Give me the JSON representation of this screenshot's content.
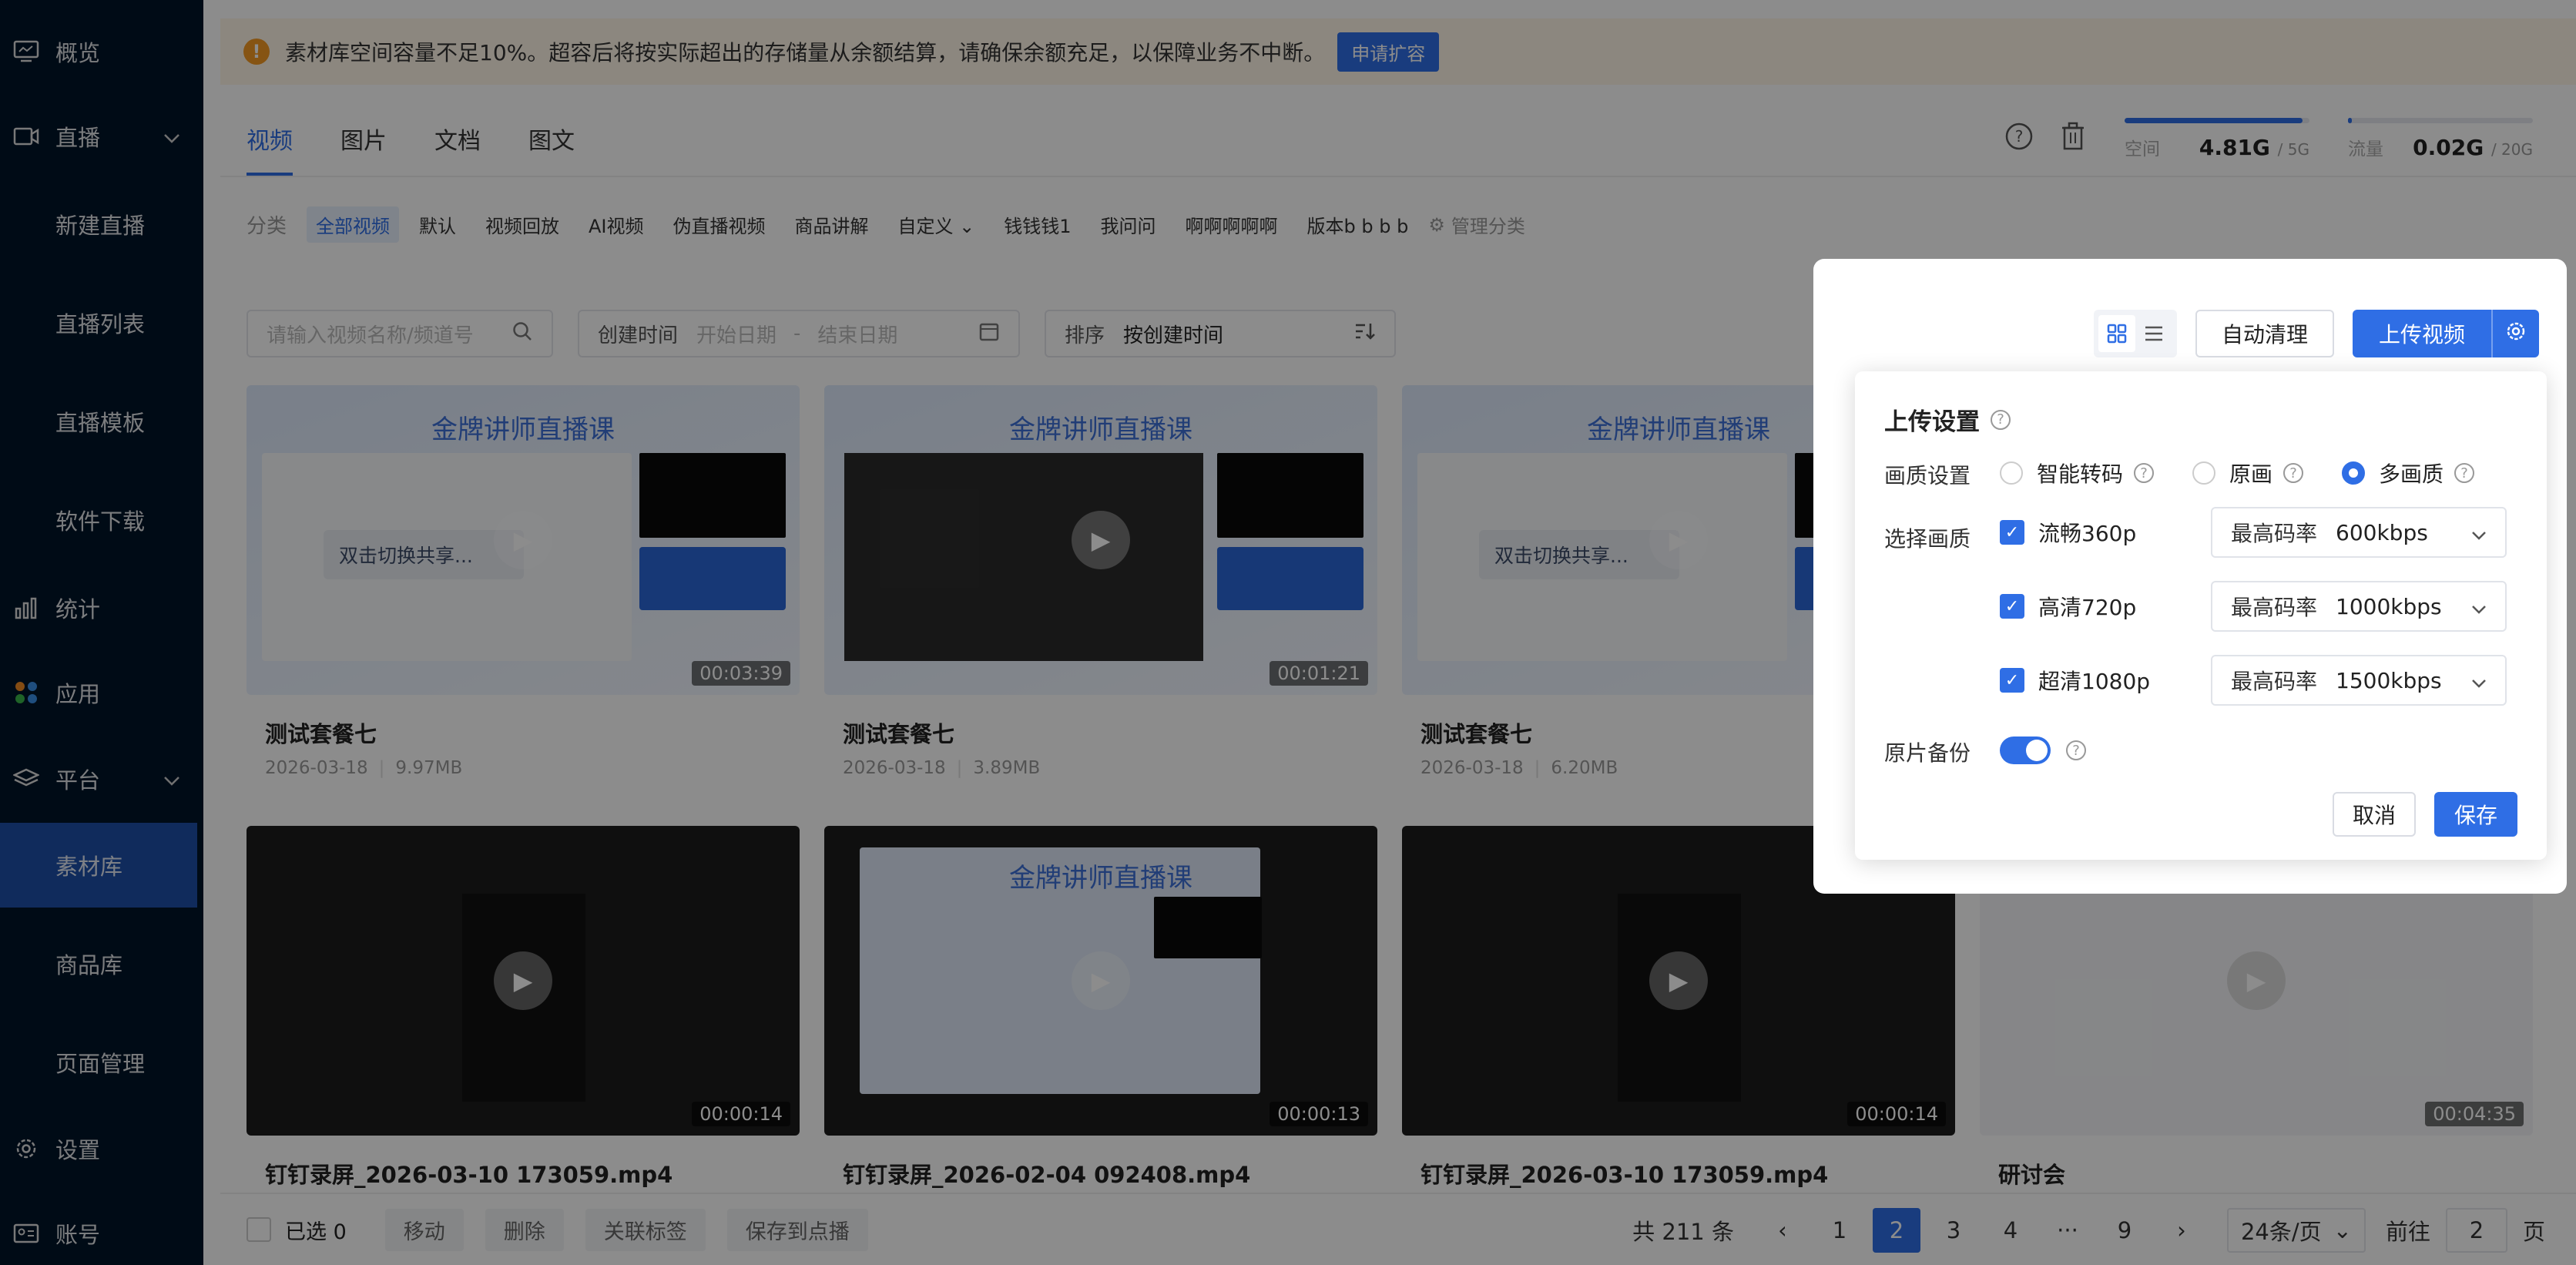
{
  "sidebar": {
    "items": [
      {
        "label": "概览",
        "icon": "monitor-icon"
      },
      {
        "label": "直播",
        "icon": "video-camera-icon"
      },
      {
        "label": "新建直播"
      },
      {
        "label": "直播列表"
      },
      {
        "label": "直播模板"
      },
      {
        "label": "软件下载"
      },
      {
        "label": "统计",
        "icon": "bar-chart-icon"
      },
      {
        "label": "应用",
        "icon": "apps-icon"
      },
      {
        "label": "平台",
        "icon": "layers-icon"
      },
      {
        "label": "素材库"
      },
      {
        "label": "商品库"
      },
      {
        "label": "页面管理"
      },
      {
        "label": "设置",
        "icon": "gear-icon"
      },
      {
        "label": "账号",
        "icon": "id-card-icon"
      }
    ]
  },
  "alert": {
    "text": "素材库空间容量不足10%。超容后将按实际超出的存储量从余额结算，请确保余额充足，以保障业务不中断。",
    "button": "申请扩容"
  },
  "tabs": [
    "视频",
    "图片",
    "文档",
    "图文"
  ],
  "quota": {
    "space_label": "空间",
    "space_used": "4.81G",
    "space_total": "/ 5G",
    "space_fraction": 0.962,
    "flow_label": "流量",
    "flow_used": "0.02G",
    "flow_total": "/ 20G",
    "flow_fraction": 0.001
  },
  "categories": {
    "label": "分类",
    "items": [
      "全部视频",
      "默认",
      "视频回放",
      "AI视频",
      "伪直播视频",
      "商品讲解",
      "自定义",
      "钱钱钱1",
      "我问问",
      "啊啊啊啊啊",
      "版本b b b b"
    ],
    "manage": "管理分类"
  },
  "filters": {
    "search_placeholder": "请输入视频名称/频道号",
    "date_label": "创建时间",
    "date_start": "开始日期",
    "date_sep": "-",
    "date_end": "结束日期",
    "sort_label": "排序",
    "sort_value": "按创建时间"
  },
  "thumb_text": {
    "heading": "金牌讲师直播课",
    "share": "双击切换共享..."
  },
  "videos": [
    {
      "title": "测试套餐七",
      "date": "2026-03-18",
      "size": "9.97MB",
      "duration": "00:03:39"
    },
    {
      "title": "测试套餐七",
      "date": "2026-03-18",
      "size": "3.89MB",
      "duration": "00:01:21"
    },
    {
      "title": "测试套餐七",
      "date": "2026-03-18",
      "size": "6.20MB",
      "duration": ""
    },
    {
      "title": "钉钉录屏_2026-03-10 173059.mp4",
      "duration": "00:00:14"
    },
    {
      "title": "钉钉录屏_2026-02-04 092408.mp4",
      "duration": "00:00:13"
    },
    {
      "title": "钉钉录屏_2026-03-10 173059.mp4",
      "duration": "00:00:14"
    },
    {
      "title": "研讨会",
      "duration": "00:04:35"
    }
  ],
  "bottom": {
    "selected": "已选 0",
    "actions": [
      "移动",
      "删除",
      "关联标签",
      "保存到点播"
    ]
  },
  "pager": {
    "total": "共 211 条",
    "prev": "‹",
    "pages": [
      "1",
      "2",
      "3",
      "4",
      "···",
      "9"
    ],
    "current": "2",
    "next": "›",
    "page_size": "24条/页",
    "goto_label": "前往",
    "goto_value": "2",
    "goto_suffix": "页"
  },
  "popover": {
    "auto_clean": "自动清理",
    "upload": "上传视频",
    "panel": {
      "title": "上传设置",
      "quality_label": "画质设置",
      "quality_options": [
        "智能转码",
        "原画",
        "多画质"
      ],
      "quality_selected": "多画质",
      "select_label": "选择画质",
      "rows": [
        {
          "name": "流畅360p",
          "rate_label": "最高码率",
          "rate": "600kbps"
        },
        {
          "name": "高清720p",
          "rate_label": "最高码率",
          "rate": "1000kbps"
        },
        {
          "name": "超清1080p",
          "rate_label": "最高码率",
          "rate": "1500kbps"
        }
      ],
      "backup_label": "原片备份",
      "backup_on": true,
      "cancel": "取消",
      "save": "保存"
    }
  },
  "colors": {
    "primary": "#2f6ee5",
    "sidebar_bg": "#001529",
    "warning": "#f59a23"
  }
}
